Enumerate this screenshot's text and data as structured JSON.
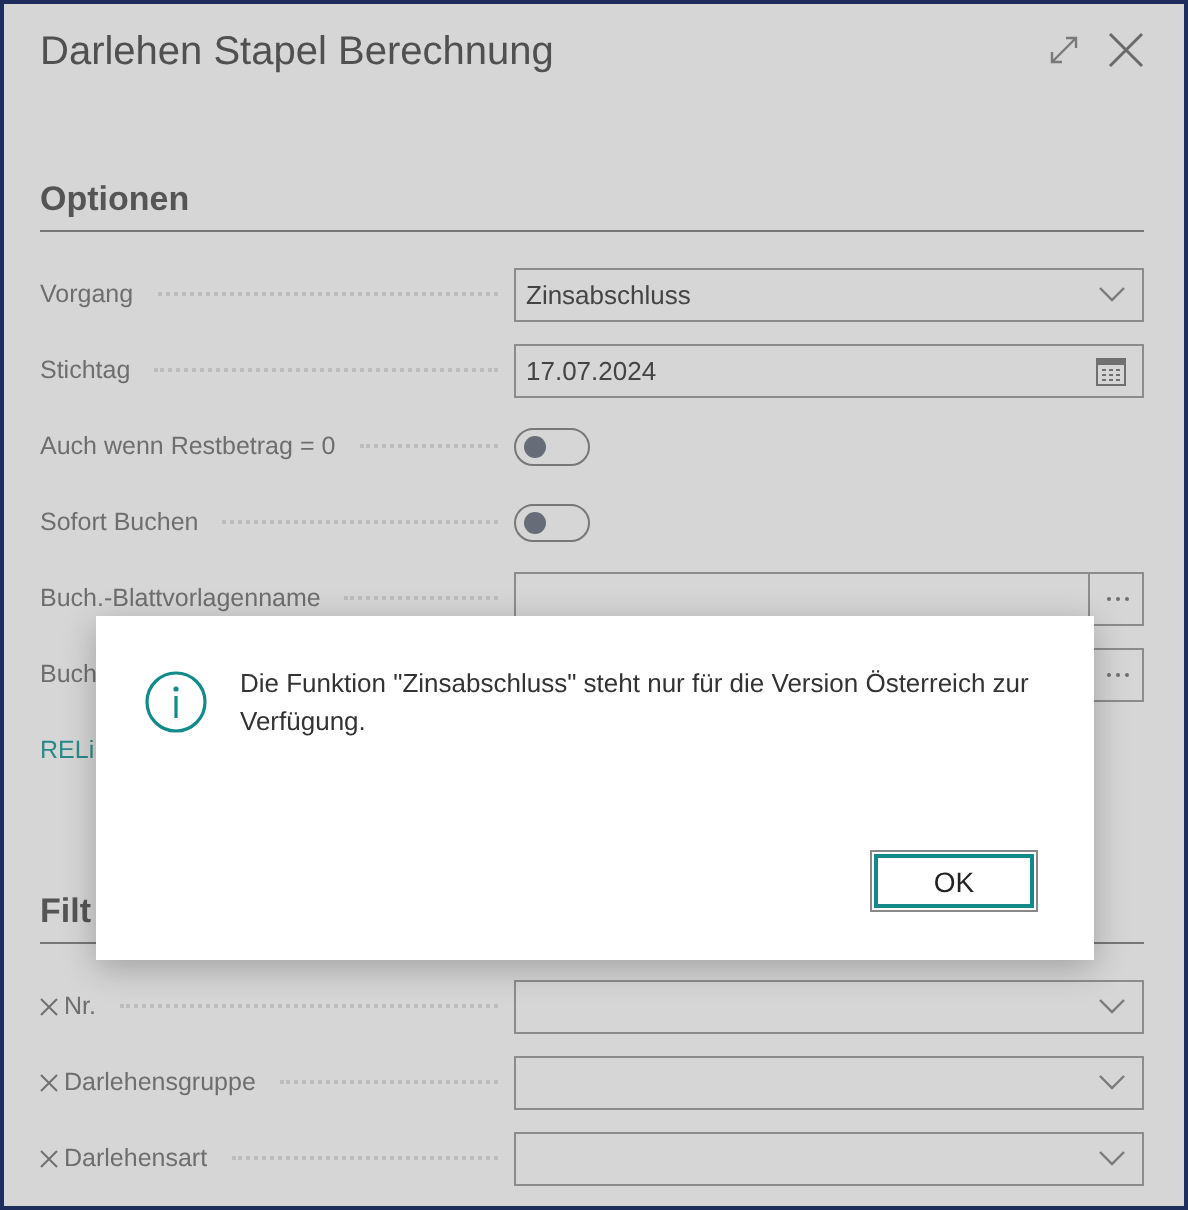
{
  "window": {
    "title": "Darlehen Stapel Berechnung"
  },
  "sections": [
    {
      "heading": "Optionen",
      "kind": "options",
      "fields": [
        {
          "label": "Vorgang",
          "kind": "dropdown",
          "value": "Zinsabschluss"
        },
        {
          "label": "Stichtag",
          "kind": "date",
          "value": "17.07.2024"
        },
        {
          "label": "Auch wenn Restbetrag = 0",
          "kind": "toggle",
          "on": false
        },
        {
          "label": "Sofort Buchen",
          "kind": "toggle",
          "on": false
        },
        {
          "label": "Buch.-Blattvorlagenname",
          "kind": "lookup"
        },
        {
          "label": "Buch",
          "kind": "lookup"
        }
      ],
      "link": "RELi"
    },
    {
      "heading": "Filt",
      "kind": "filters",
      "fields": [
        {
          "label": "Nr.",
          "kind": "dropdown"
        },
        {
          "label": "Darlehensgruppe",
          "kind": "dropdown"
        },
        {
          "label": "Darlehensart",
          "kind": "dropdown"
        }
      ]
    }
  ],
  "dialog": {
    "message": "Die Funktion \"Zinsabschluss\" steht nur für die Version Österreich zur Verfügung.",
    "buttons": [
      {
        "label": "OK",
        "focused": true
      }
    ]
  }
}
